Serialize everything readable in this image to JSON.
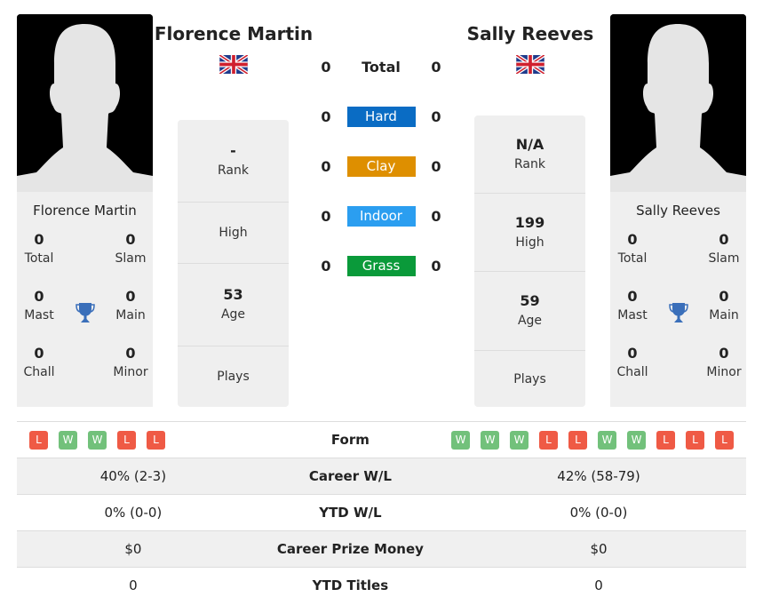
{
  "players": [
    {
      "name": "Florence Martin",
      "flag": "uk-flag-icon",
      "titles": {
        "total": "0",
        "slam": "0",
        "mast": "0",
        "main": "0",
        "chall": "0",
        "minor": "0"
      },
      "stats": {
        "rank": "-",
        "high": "",
        "age": "53",
        "plays": ""
      },
      "form": [
        "L",
        "W",
        "W",
        "L",
        "L"
      ],
      "career_wl": "40% (2-3)",
      "ytd_wl": "0% (0-0)",
      "prize_money": "$0",
      "ytd_titles": "0"
    },
    {
      "name": "Sally Reeves",
      "flag": "uk-flag-icon",
      "titles": {
        "total": "0",
        "slam": "0",
        "mast": "0",
        "main": "0",
        "chall": "0",
        "minor": "0"
      },
      "stats": {
        "rank": "N/A",
        "high": "199",
        "age": "59",
        "plays": ""
      },
      "form": [
        "W",
        "W",
        "W",
        "L",
        "L",
        "W",
        "W",
        "L",
        "L",
        "L"
      ],
      "career_wl": "42% (58-79)",
      "ytd_wl": "0% (0-0)",
      "prize_money": "$0",
      "ytd_titles": "0"
    }
  ],
  "title_labels": {
    "total": "Total",
    "slam": "Slam",
    "mast": "Mast",
    "main": "Main",
    "chall": "Chall",
    "minor": "Minor"
  },
  "stat_labels": {
    "rank": "Rank",
    "high": "High",
    "age": "Age",
    "plays": "Plays"
  },
  "h2h": [
    {
      "label": "Total",
      "left": "0",
      "right": "0",
      "color": null
    },
    {
      "label": "Hard",
      "left": "0",
      "right": "0",
      "color": "#0a6cc4"
    },
    {
      "label": "Clay",
      "left": "0",
      "right": "0",
      "color": "#de8f00"
    },
    {
      "label": "Indoor",
      "left": "0",
      "right": "0",
      "color": "#2b9ef0"
    },
    {
      "label": "Grass",
      "left": "0",
      "right": "0",
      "color": "#0a9a3a"
    }
  ],
  "compare_labels": {
    "form": "Form",
    "career_wl": "Career W/L",
    "ytd_wl": "YTD W/L",
    "prize_money": "Career Prize Money",
    "ytd_titles": "YTD Titles"
  }
}
